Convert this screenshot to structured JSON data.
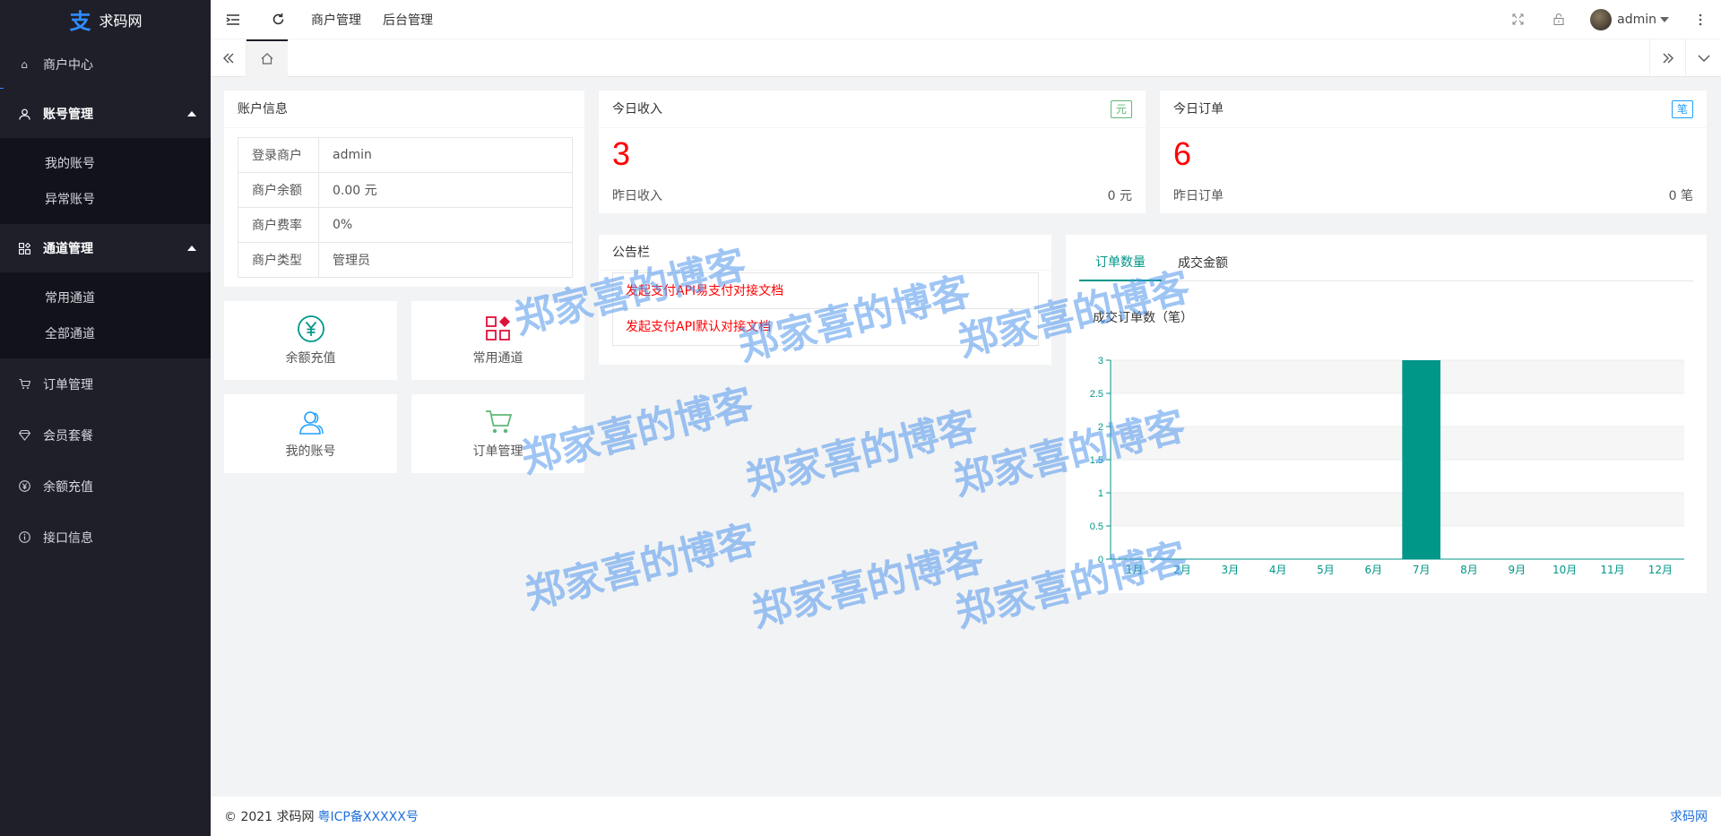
{
  "app": {
    "logo_glyph": "支",
    "name": "求码网"
  },
  "sidebar": {
    "items": [
      {
        "label": "商户中心",
        "icon": "home-icon"
      },
      {
        "label": "账号管理",
        "icon": "user-icon",
        "expanded": true,
        "children": [
          "我的账号",
          "异常账号"
        ]
      },
      {
        "label": "通道管理",
        "icon": "grid-icon",
        "expanded": true,
        "children": [
          "常用通道",
          "全部通道"
        ]
      },
      {
        "label": "订单管理",
        "icon": "cart-icon"
      },
      {
        "label": "会员套餐",
        "icon": "diamond-icon"
      },
      {
        "label": "余额充值",
        "icon": "yen-icon"
      },
      {
        "label": "接口信息",
        "icon": "info-icon"
      }
    ]
  },
  "header": {
    "links": [
      "商户管理",
      "后台管理"
    ],
    "user": "admin"
  },
  "account": {
    "title": "账户信息",
    "rows": [
      {
        "k": "登录商户",
        "v": "admin"
      },
      {
        "k": "商户余额",
        "v": "0.00 元"
      },
      {
        "k": "商户费率",
        "v": "0%"
      },
      {
        "k": "商户类型",
        "v": "管理员"
      }
    ]
  },
  "income": {
    "title": "今日收入",
    "badge": "元",
    "value": "3",
    "sub_label": "昨日收入",
    "sub_value": "0 元",
    "badge_color": "#5fb878"
  },
  "orders": {
    "title": "今日订单",
    "badge": "笔",
    "value": "6",
    "sub_label": "昨日订单",
    "sub_value": "0 笔",
    "badge_color": "#1e9fff"
  },
  "shortcuts": [
    {
      "label": "余额充值",
      "icon": "yen-circle-icon",
      "color": "#009688"
    },
    {
      "label": "常用通道",
      "icon": "apps-icon",
      "color": "#e0103a"
    },
    {
      "label": "我的账号",
      "icon": "users-icon",
      "color": "#1e9fff"
    },
    {
      "label": "订单管理",
      "icon": "cart-icon",
      "color": "#5fb878"
    }
  ],
  "notice": {
    "title": "公告栏",
    "items": [
      "发起支付API易支付对接文档",
      "发起支付API默认对接文档"
    ]
  },
  "chart_tabs": [
    "订单数量",
    "成交金额"
  ],
  "chart_data": {
    "type": "bar",
    "title": "成交订单数（笔）",
    "categories": [
      "1月",
      "2月",
      "3月",
      "4月",
      "5月",
      "6月",
      "7月",
      "8月",
      "9月",
      "10月",
      "11月",
      "12月"
    ],
    "values": [
      0,
      0,
      0,
      0,
      0,
      0,
      3,
      0,
      0,
      0,
      0,
      0
    ],
    "ylim": [
      0,
      3
    ],
    "yticks": [
      "0",
      "0.5",
      "1",
      "1.5",
      "2",
      "2.5",
      "3"
    ],
    "color": "#009688"
  },
  "watermark": "郑家喜的博客",
  "footer": {
    "copyright": "© 2021 求码网",
    "icp": "粤ICP备XXXXX号",
    "right": "求码网"
  }
}
